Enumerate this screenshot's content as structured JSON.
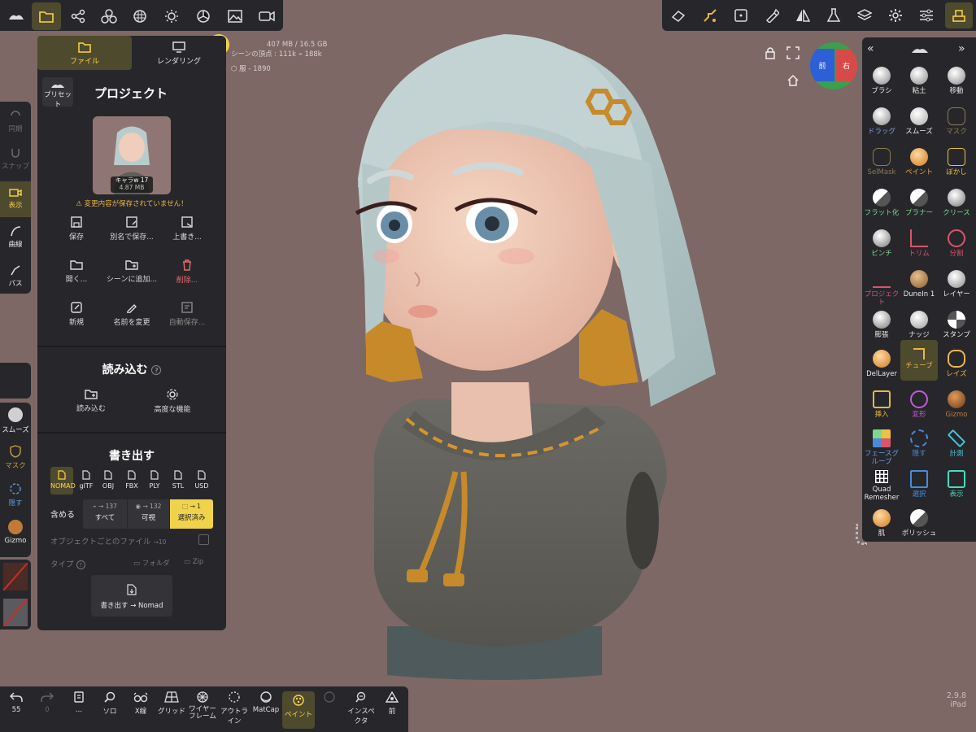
{
  "stats": {
    "memory": "407 MB / 16.5 GB",
    "scene_vertices": "シーンの頂点 : 111k",
    "link_count": "188k",
    "object_name": "服",
    "object_count": "1890"
  },
  "view_cube": {
    "front": "前",
    "right": "右"
  },
  "file_panel": {
    "tab_file": "ファイル",
    "tab_render": "レンダリング",
    "preset_label": "プリセット",
    "title": "プロジェクト",
    "thumb_name": "キャラw 17",
    "thumb_size": "4.87 MB",
    "warning": "⚠ 変更内容が保存されていません！",
    "actions": [
      {
        "label": "保存"
      },
      {
        "label": "別名で保存..."
      },
      {
        "label": "上書き..."
      },
      {
        "label": "開く..."
      },
      {
        "label": "シーンに追加..."
      },
      {
        "label": "削除..."
      },
      {
        "label": "新規"
      },
      {
        "label": "名前を変更"
      },
      {
        "label": "自動保存..."
      }
    ],
    "import_title": "読み込む",
    "import_btn": "読み込む",
    "advanced_btn": "高度な機能",
    "export_title": "書き出す",
    "formats": [
      "NOMAD",
      "glTF",
      "OBJ",
      "FBX",
      "PLY",
      "STL",
      "USD"
    ],
    "include_label": "含める",
    "include_all": "すべて",
    "include_all_count": "→ 137",
    "include_visible": "可視",
    "include_visible_count": "→ 132",
    "include_selected": "選択済み",
    "include_selected_count": "→ 1",
    "per_object": "オブジェクトごとのファイル",
    "per_object_count": "→10",
    "type_label": "タイプ",
    "folder_label": "フォルダ",
    "zip_label": "Zip",
    "export_btn": "書き出す → Nomad"
  },
  "left_side": {
    "sync": "同期",
    "snap": "スナップ",
    "display": "表示",
    "curve": "曲線",
    "path": "パス",
    "smooth": "スムーズ",
    "mask": "マスク",
    "hide": "隠す",
    "gizmo": "Gizmo"
  },
  "tools": [
    {
      "label": "ブラシ",
      "color": "#b8b8b8"
    },
    {
      "label": "粘土",
      "color": "#b8b8b8"
    },
    {
      "label": "移動",
      "color": "#b8b8b8"
    },
    {
      "label": "ドラッグ",
      "color": "#b8b8b8"
    },
    {
      "label": "スムーズ",
      "color": "#c8c8c8"
    },
    {
      "label": "マスク",
      "color": "#8a7a55"
    },
    {
      "label": "SelMask",
      "color": "#8a7a55"
    },
    {
      "label": "ペイント",
      "color": "#e8a24a"
    },
    {
      "label": "ぼかし",
      "color": "#e8c24a"
    },
    {
      "label": "フラット化",
      "color": "#b8b8b8"
    },
    {
      "label": "プラナー",
      "color": "#b8b8b8"
    },
    {
      "label": "クリース",
      "color": "#b8b8b8"
    },
    {
      "label": "ピンチ",
      "color": "#b8b8b8"
    },
    {
      "label": "トリム",
      "color": "#d9556e"
    },
    {
      "label": "分割",
      "color": "#d9556e"
    },
    {
      "label": "プロジェクト",
      "color": "#d9556e"
    },
    {
      "label": "DuneIn 1",
      "color": "#b88a5a"
    },
    {
      "label": "レイヤー",
      "color": "#b8b8b8"
    },
    {
      "label": "膨張",
      "color": "#b8b8b8"
    },
    {
      "label": "ナッジ",
      "color": "#b8b8b8"
    },
    {
      "label": "スタンプ",
      "color": "#b8b8b8"
    },
    {
      "label": "DelLayer",
      "color": "#e8a24a"
    },
    {
      "label": "チューブ",
      "color": "#e8b64a"
    },
    {
      "label": "レイズ",
      "color": "#e8b64a"
    },
    {
      "label": "挿入",
      "color": "#e8b64a"
    },
    {
      "label": "変形",
      "color": "#c05ad9"
    },
    {
      "label": "Gizmo",
      "color": "#c07a3a"
    },
    {
      "label": "フェースグループ",
      "color": "#e8c24a"
    },
    {
      "label": "隠す",
      "color": "#4a8ad9"
    },
    {
      "label": "計測",
      "color": "#4ac0d9"
    },
    {
      "label": "Quad Remesher",
      "color": "#ffffff"
    },
    {
      "label": "選択",
      "color": "#4a8ad9"
    },
    {
      "label": "表示",
      "color": "#4ad9c0"
    },
    {
      "label": "肌",
      "color": "#e8a24a"
    },
    {
      "label": "ポリッシュ",
      "color": "#c8c8c8"
    }
  ],
  "bottom": {
    "undo": "55",
    "redo": "0",
    "more": "...",
    "solo": "ソロ",
    "xray": "X線",
    "grid": "グリッド",
    "wireframe": "ワイヤーフレーム",
    "outline": "アウトライン",
    "matcap": "MatCap",
    "paint": "ペイント",
    "inspector": "インスペクタ",
    "front": "前"
  },
  "version": {
    "number": "2.9.8",
    "device": "iPad"
  }
}
